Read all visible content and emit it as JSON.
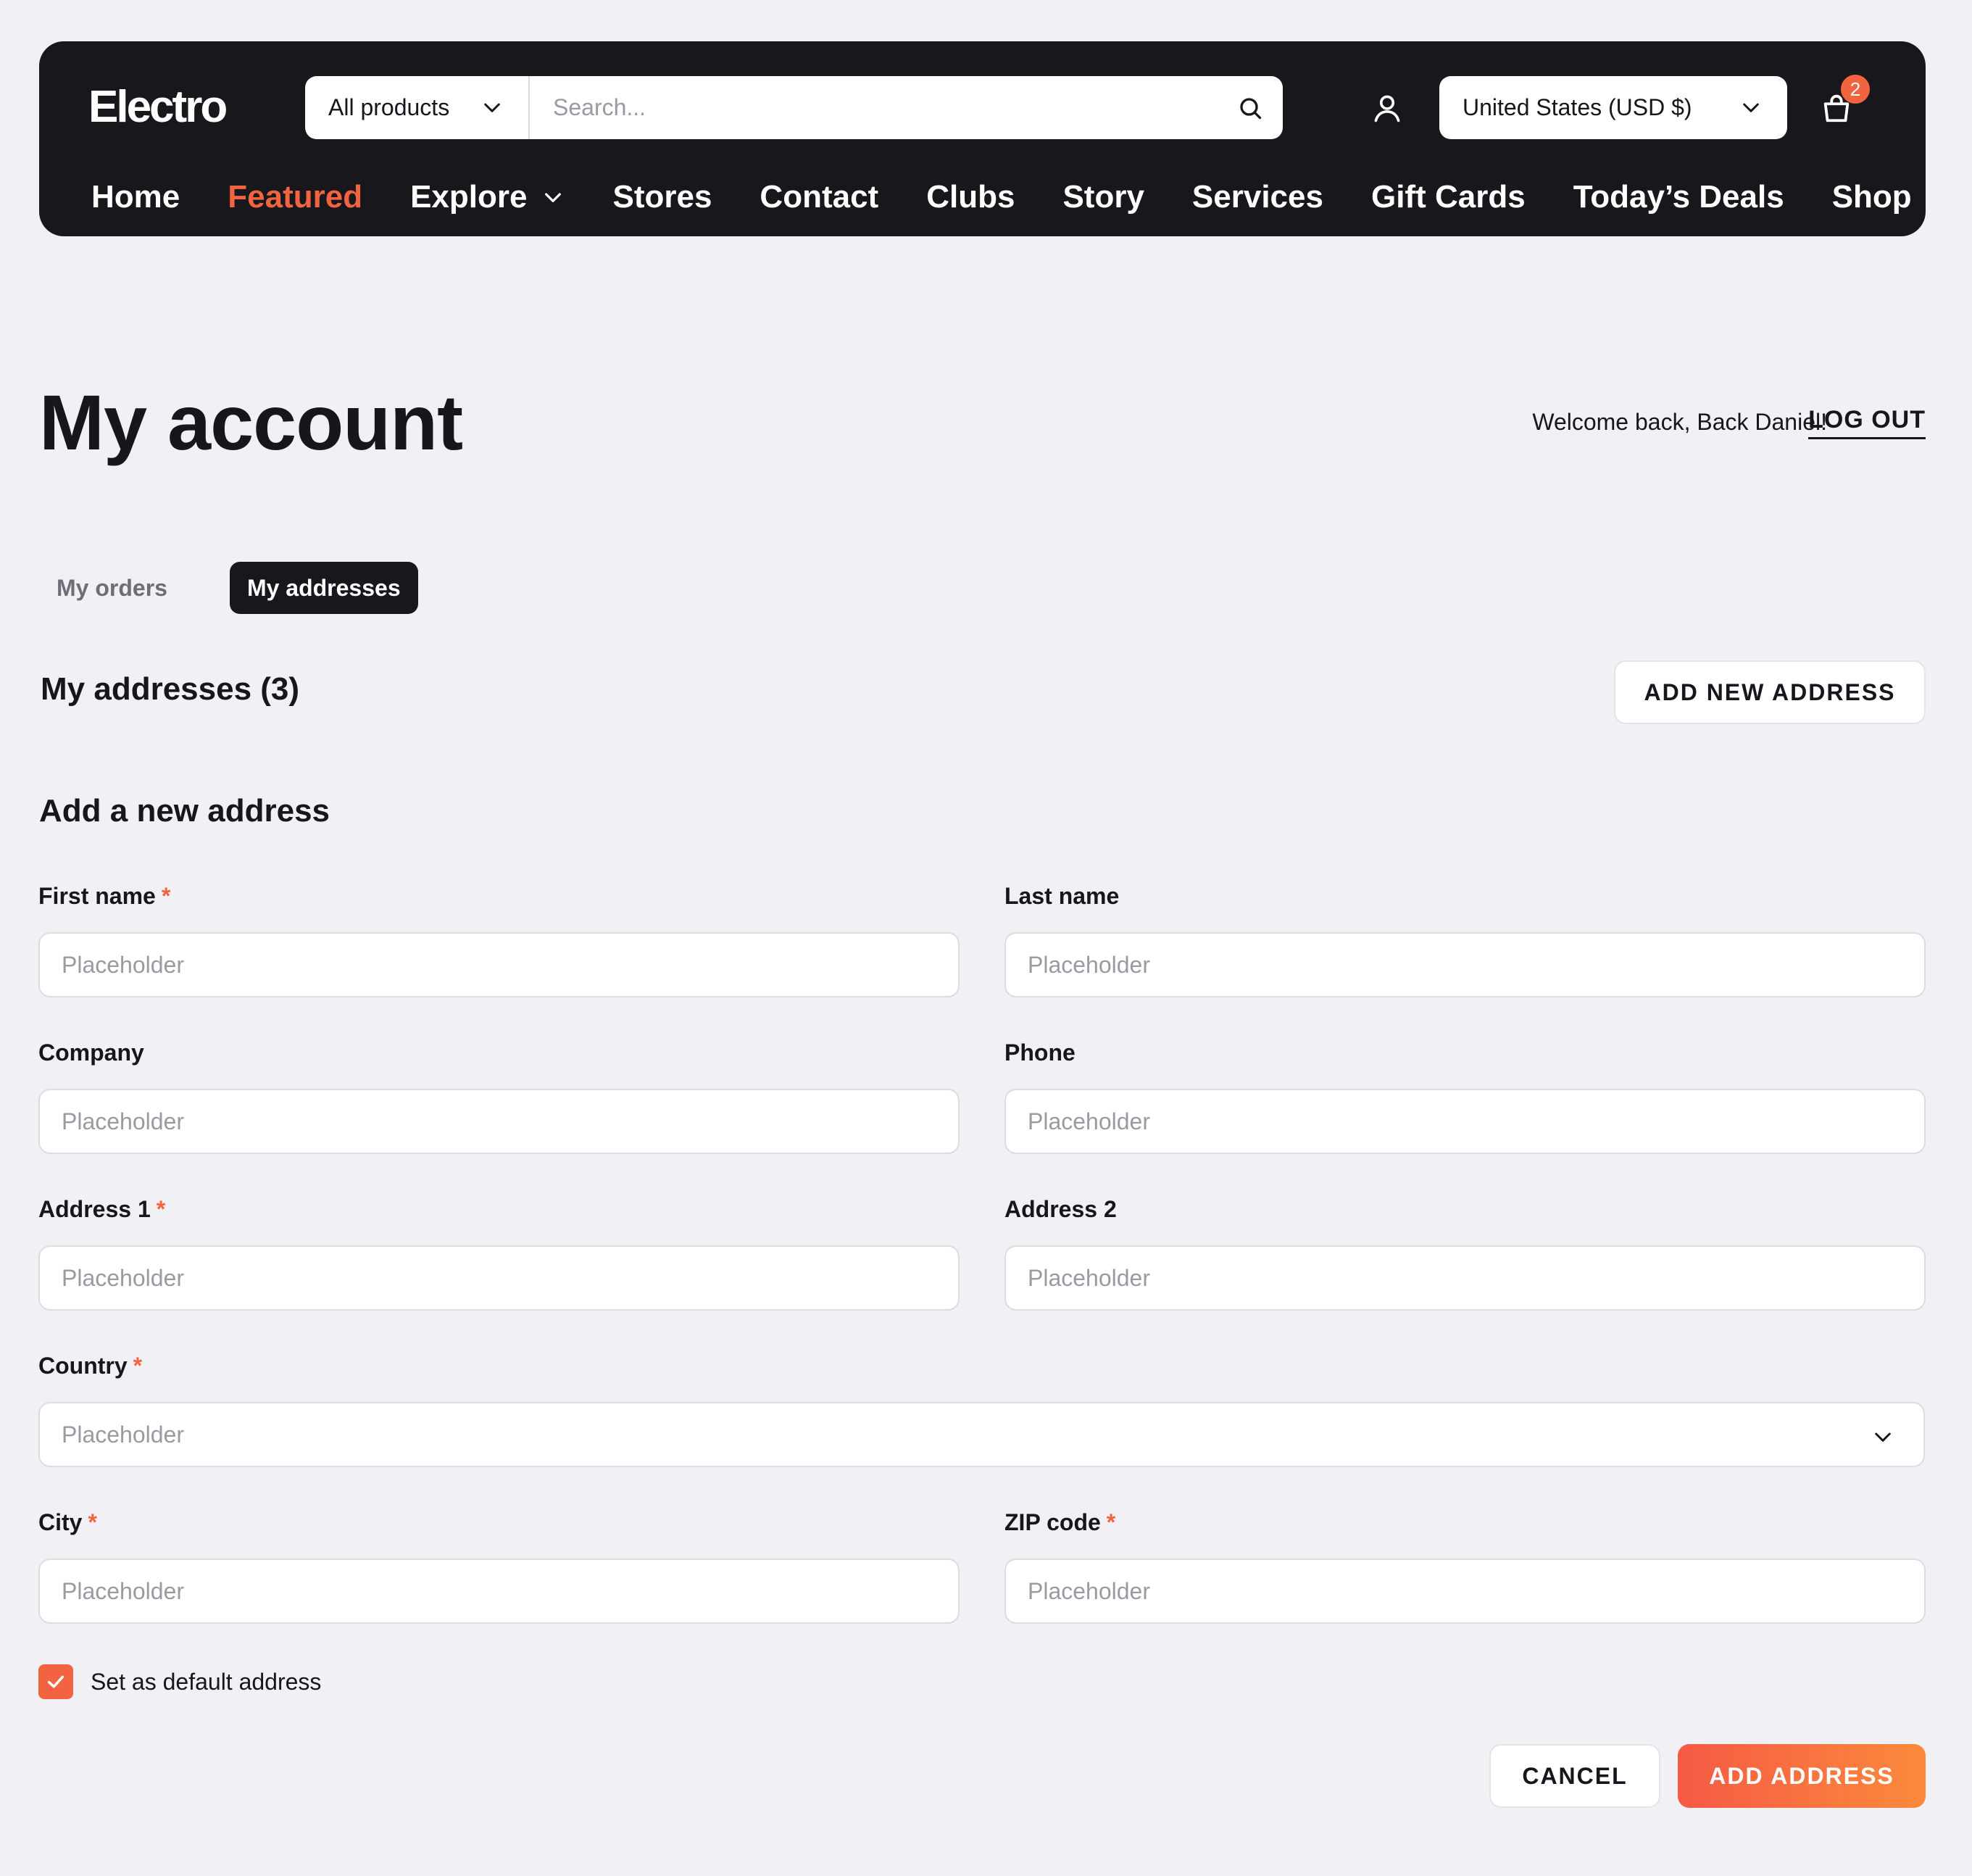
{
  "header": {
    "logo": "Electro",
    "category_select": "All products",
    "search_placeholder": "Search...",
    "currency": "United States (USD $)",
    "cart_count": "2",
    "nav": [
      {
        "label": "Home"
      },
      {
        "label": "Featured",
        "active": true
      },
      {
        "label": "Explore",
        "has_dropdown": true
      },
      {
        "label": "Stores"
      },
      {
        "label": "Contact"
      },
      {
        "label": "Clubs"
      },
      {
        "label": "Story"
      },
      {
        "label": "Services"
      },
      {
        "label": "Gift Cards"
      },
      {
        "label": "Today’s Deals"
      },
      {
        "label": "Shop"
      }
    ]
  },
  "account": {
    "title": "My account",
    "welcome": "Welcome back, Back Daniel!",
    "logout": "LOG OUT",
    "tabs": [
      {
        "label": "My orders",
        "active": false
      },
      {
        "label": "My addresses",
        "active": true
      }
    ],
    "addresses_title": "My addresses (3)",
    "add_new_button": "ADD NEW ADDRESS"
  },
  "form": {
    "title": "Add a new address",
    "fields": {
      "first_name": {
        "label": "First name",
        "required": true,
        "placeholder": "Placeholder"
      },
      "last_name": {
        "label": "Last name",
        "required": false,
        "placeholder": "Placeholder"
      },
      "company": {
        "label": "Company",
        "required": false,
        "placeholder": "Placeholder"
      },
      "phone": {
        "label": "Phone",
        "required": false,
        "placeholder": "Placeholder"
      },
      "address1": {
        "label": "Address 1",
        "required": true,
        "placeholder": "Placeholder"
      },
      "address2": {
        "label": "Address 2",
        "required": false,
        "placeholder": "Placeholder"
      },
      "country": {
        "label": "Country",
        "required": true,
        "placeholder": "Placeholder"
      },
      "city": {
        "label": "City",
        "required": true,
        "placeholder": "Placeholder"
      },
      "zip": {
        "label": "ZIP code",
        "required": true,
        "placeholder": "Placeholder"
      }
    },
    "required_mark": "*",
    "default_checkbox": {
      "label": "Set as default address",
      "checked": true
    },
    "cancel_button": "CANCEL",
    "submit_button": "ADD ADDRESS"
  },
  "colors": {
    "accent": "#f2633f",
    "header_bg": "#17171c",
    "page_bg": "#f0f0f5"
  },
  "icons": {
    "search": "search-icon",
    "user": "user-icon",
    "cart": "shopping-bag-icon",
    "dropdown": "chevron-down-icon",
    "check": "check-icon"
  }
}
